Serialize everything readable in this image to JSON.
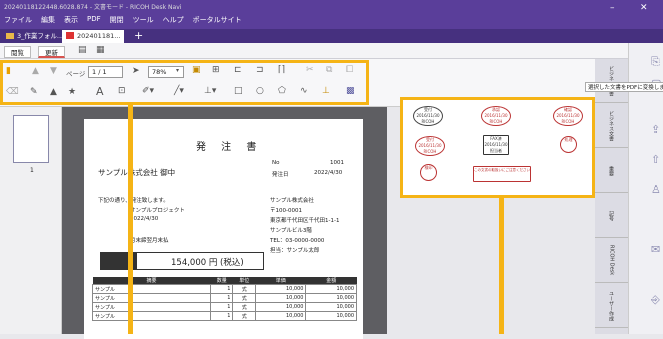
{
  "window": {
    "title": "20240118122448.6028.874 - 文書モード - RICOH Desk Navi",
    "menu": [
      "ファイル",
      "編集",
      "表示",
      "PDF",
      "開閉",
      "ツール",
      "ヘルプ",
      "ポータルサイト"
    ]
  },
  "tabs": [
    {
      "label": "3_作業フォル..."
    },
    {
      "label": "202401181..."
    }
  ],
  "ribbon_tabs": [
    "閲覧",
    "更新"
  ],
  "toolbar": {
    "page_label": "ページ",
    "page_value": "1 / 1",
    "zoom_value": "78%",
    "text_label": "A"
  },
  "thumbnail": {
    "page_number": "1"
  },
  "document": {
    "title": "発 注 書",
    "to_company": "サンプル株式会社 御中",
    "no_label": "No",
    "no_value": "1001",
    "date_label": "発注日",
    "date_value": "2022/4/30",
    "intro": "下記の通り、発注致します。",
    "project": "サンプルプロジェクト",
    "due": "2022/4/30",
    "terms": "月末締翌月末払",
    "from_company": "サンプル株式会社",
    "postal": "〒100-0001",
    "address": "東京都千代田区千代田1-1-1",
    "building": "サンプルビル3階",
    "tel": "TEL：03-0000-0000",
    "person": "担当：サンプル太郎",
    "amount": "154,000 円 (税込)",
    "table_headers": [
      "摘要",
      "数量",
      "単位",
      "単価",
      "金額"
    ],
    "rows": [
      {
        "name": "サンプル",
        "qty": "1",
        "unit": "式",
        "price": "10,000",
        "total": "10,000"
      },
      {
        "name": "サンプル",
        "qty": "1",
        "unit": "式",
        "price": "10,000",
        "total": "10,000"
      },
      {
        "name": "サンプル",
        "qty": "1",
        "unit": "式",
        "price": "10,000",
        "total": "10,000"
      },
      {
        "name": "サンプル",
        "qty": "1",
        "unit": "式",
        "price": "10,000",
        "total": "10,000"
      }
    ]
  },
  "stamps": {
    "s1_top": "受付",
    "s1_date": "2016/11/30",
    "s1_bottom": "RICOH",
    "s2_top": "承認",
    "s3_top": "確認",
    "s4_top": "受付",
    "s5": "FAX済",
    "s6_top": "処理",
    "s7_top": "検印",
    "s8": "この文書の取扱いにご注意ください",
    "fax_date": "2016/11/30",
    "fax_bottom": "担当者"
  },
  "right_tabs": [
    "ビジネス文書",
    "ビジネス文書",
    "重要",
    "記号",
    "RICOH Desk",
    "ユーザー作成"
  ],
  "tooltip": "選択した文書をPDFに変換します"
}
